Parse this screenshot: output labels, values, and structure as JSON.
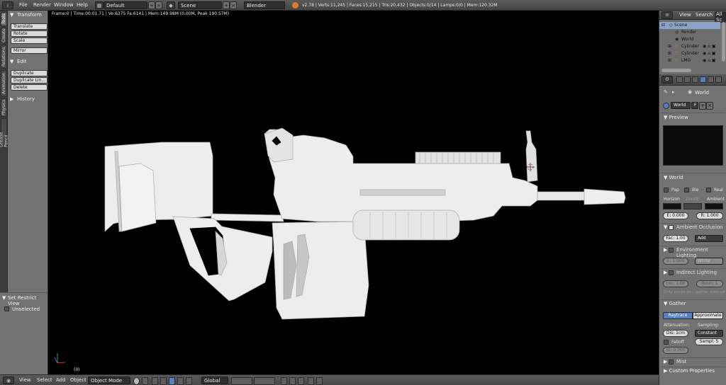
{
  "top": {
    "menus": [
      "File",
      "Render",
      "Window",
      "Help"
    ],
    "layout": "Default",
    "scene": "Scene",
    "engine": "Blender Render",
    "stats": "v2.78 | Verts:11,245 | Faces:15,215 | Tris:20,432 | Objects:0/14 | Lamps:0/0 | Mem:120.32M"
  },
  "vtabs": [
    "Tools",
    "Create",
    "Relations",
    "Animation",
    "Physics",
    "Grease Pencil"
  ],
  "toolshelf": {
    "transform_title": "Transform",
    "transform_buttons": [
      "Translate",
      "Rotate",
      "Scale"
    ],
    "mirror": "Mirror",
    "edit_title": "Edit",
    "edit_buttons": [
      "Duplicate",
      "Duplicate Lin...",
      "Delete"
    ],
    "history_title": "History",
    "restrict_title": "Set Restrict View",
    "unselected": "Unselected"
  },
  "viewport": {
    "info": "Frame:0 | Time:00:01.71 | Ve:6375 Fa:6141 | Mem:149.98M (0.00M, Peak 190.57M)",
    "frame": "(0)"
  },
  "bottom": {
    "menus": [
      "View",
      "Select",
      "Add",
      "Object"
    ],
    "mode": "Object Mode",
    "orientation": "Global"
  },
  "outliner": {
    "view": "View",
    "search": "Search",
    "all_scenes": "All Sc",
    "rows": [
      "Scene",
      "Render",
      "World",
      "Cylinder",
      "Cylinder",
      "LMG"
    ]
  },
  "properties": {
    "world_crumb": "World",
    "world_name": "World",
    "world_f": "F",
    "preview": "Preview",
    "world_title": "World",
    "checks": [
      "Pap",
      "Ble",
      "Real"
    ],
    "horizon": "Horizon",
    "zenith": "Zenith",
    "ambient": "Ambient",
    "e_val": "E: 0.000",
    "r_val": "R: 1.000",
    "ao_title": "Ambient Occlusion",
    "ao_fac": "Fac: 1.00",
    "ao_mode": "Add",
    "env_title": "Environment Lighting",
    "env_e": "E: 1.000",
    "env_color": "White",
    "ind_title": "Indirect Lighting",
    "ind_fac": "Fac: 1.00",
    "ind_boun": "Boun: 1",
    "ind_note": "Only works wi... gather method",
    "gather_title": "Gather",
    "raytrace": "Raytrace",
    "approximate": "Approximate",
    "attenuation": "Attenuation:",
    "sampling": "Sampling:",
    "dist": "Dis: 1cm",
    "constant": "Constant",
    "falloff": "Falloff",
    "sampl": "Sampl: 5",
    "str": "St: 0.000",
    "mist": "Mist",
    "custom": "Custom Properties"
  }
}
